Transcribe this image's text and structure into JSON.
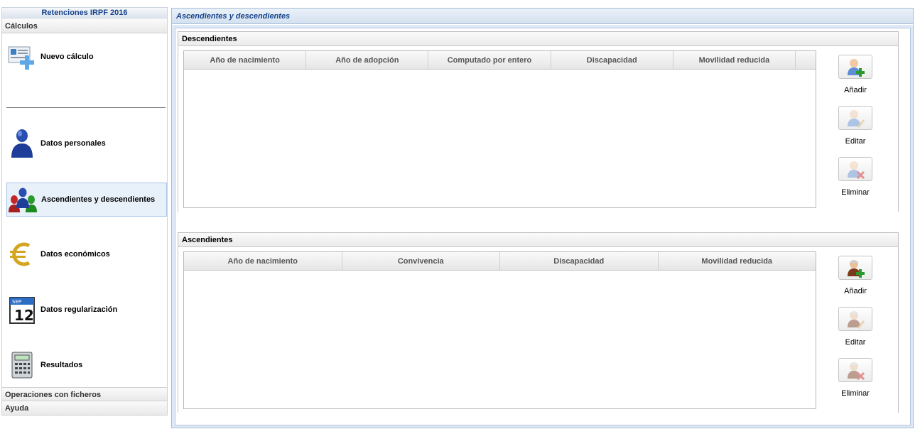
{
  "app": {
    "title": "Retenciones IRPF 2016"
  },
  "sidebar": {
    "section_calculos": "Cálculos",
    "items": [
      {
        "label": "Nuevo cálculo",
        "icon": "new-calc-icon"
      },
      {
        "label": "Datos personales",
        "icon": "person-icon"
      },
      {
        "label": "Ascendientes y descendientes",
        "icon": "family-icon"
      },
      {
        "label": "Datos económicos",
        "icon": "euro-icon"
      },
      {
        "label": "Datos regularización",
        "icon": "calendar-icon"
      },
      {
        "label": "Resultados",
        "icon": "calculator-icon"
      }
    ],
    "calendar_month": "SEP",
    "calendar_day": "12",
    "section_ficheros": "Operaciones con ficheros",
    "section_ayuda": "Ayuda",
    "active_item": "Ascendientes y descendientes"
  },
  "main": {
    "title": "Ascendientes y descendientes",
    "descendientes": {
      "title": "Descendientes",
      "columns": [
        "Año de nacimiento",
        "Año de adopción",
        "Computado por entero",
        "Discapacidad",
        "Movilidad reducida"
      ],
      "rows": [],
      "actions": {
        "add": "Añadir",
        "edit": "Editar",
        "delete": "Eliminar"
      }
    },
    "ascendientes": {
      "title": "Ascendientes",
      "columns": [
        "Año de nacimiento",
        "Convivencia",
        "Discapacidad",
        "Movilidad reducida"
      ],
      "rows": [],
      "actions": {
        "add": "Añadir",
        "edit": "Editar",
        "delete": "Eliminar"
      }
    }
  },
  "colors": {
    "accent": "#15428b",
    "panel_border": "#a8bdd6",
    "panel_bg": "#dfe8f6",
    "active_item_bg": "#e8f0fa"
  }
}
